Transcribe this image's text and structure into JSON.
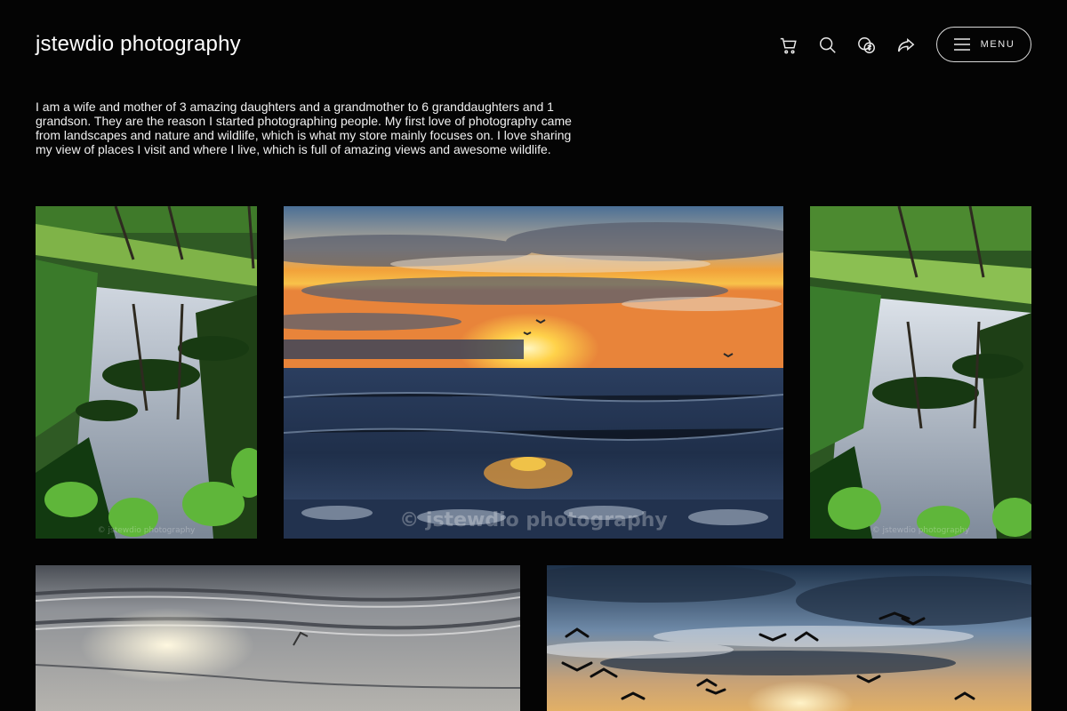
{
  "header": {
    "site_title": "jstewdio photography",
    "menu_label": "MENU",
    "icons": [
      "cart-icon",
      "search-icon",
      "currency-icon",
      "share-icon",
      "hamburger-icon"
    ]
  },
  "intro": {
    "text": "I am a wife and mother of 3 amazing daughters and a grandmother to 6 granddaughters and 1 grandson. They are the reason I started photographing people. My first love of photography came from landscapes and nature and wildlife, which is what my store mainly focuses on. I love sharing my view of places I visit and where I live, which is full of amazing views and awesome wildlife."
  },
  "gallery": {
    "photos": [
      {
        "subject": "palm trees reflected in pond",
        "watermark": "© jstewdio photography"
      },
      {
        "subject": "ocean sunset with seabirds",
        "watermark": "© jstewdio photography"
      },
      {
        "subject": "palm trees reflected in pond",
        "watermark": "© jstewdio photography"
      },
      {
        "subject": "sunlit waves on beach",
        "watermark": ""
      },
      {
        "subject": "birds flying across sunset sky",
        "watermark": ""
      }
    ]
  },
  "colors": {
    "background": "#040404",
    "text": "#f2f2f2",
    "button_border": "#d8d8d8"
  }
}
